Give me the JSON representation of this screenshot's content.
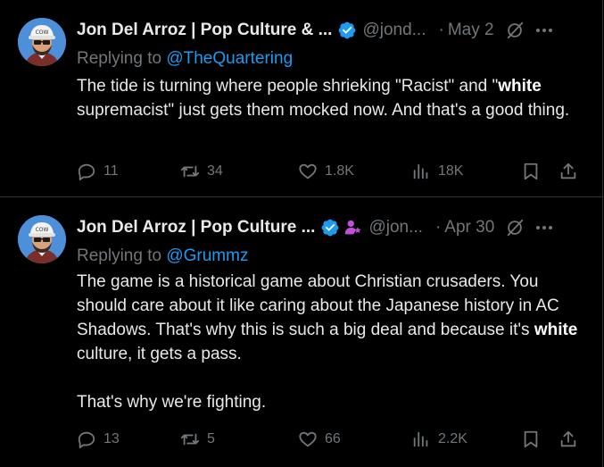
{
  "tweets": [
    {
      "author_name": "Jon Del Arroz | Pop Culture & ...",
      "handle": "@jond...",
      "separator": "·",
      "date": "May 2",
      "replying_prefix": "Replying to",
      "replying_to": "@TheQuartering",
      "text_parts": [
        "The tide is turning where people shrieking \"Racist\" and \"",
        "white",
        " supremacist\" just gets them mocked now. And that's a good thing."
      ],
      "actions": {
        "replies": "11",
        "reposts": "34",
        "likes": "1.8K",
        "views": "18K"
      }
    },
    {
      "author_name": "Jon Del Arroz | Pop Culture ...",
      "handle": "@jon...",
      "separator": "·",
      "date": "Apr 30",
      "replying_prefix": "Replying to",
      "replying_to": "@Grummz",
      "text_parts": [
        "The game is a historical game about Christian crusaders. You should care about it like caring about the Japanese history in AC Shadows. That's why this is such a big deal and because it's ",
        "white",
        " culture, it gets a pass."
      ],
      "text_second_paragraph": "That's why we're fighting.",
      "actions": {
        "replies": "13",
        "reposts": "5",
        "likes": "66",
        "views": "2.2K"
      }
    }
  ],
  "icons": {
    "verified": "verified-badge-icon",
    "affiliate": "affiliate-badge-icon",
    "grok": "grok-icon",
    "more": "more-icon",
    "reply": "reply-icon",
    "repost": "repost-icon",
    "like": "heart-icon",
    "views": "views-icon",
    "bookmark": "bookmark-icon",
    "share": "share-icon"
  },
  "colors": {
    "background": "#000000",
    "text": "#e7e9ea",
    "muted": "#71767b",
    "link": "#1d9bf0",
    "verified": "#1d9bf0",
    "divider": "#2f3336",
    "affiliate": "#c34fd8"
  }
}
